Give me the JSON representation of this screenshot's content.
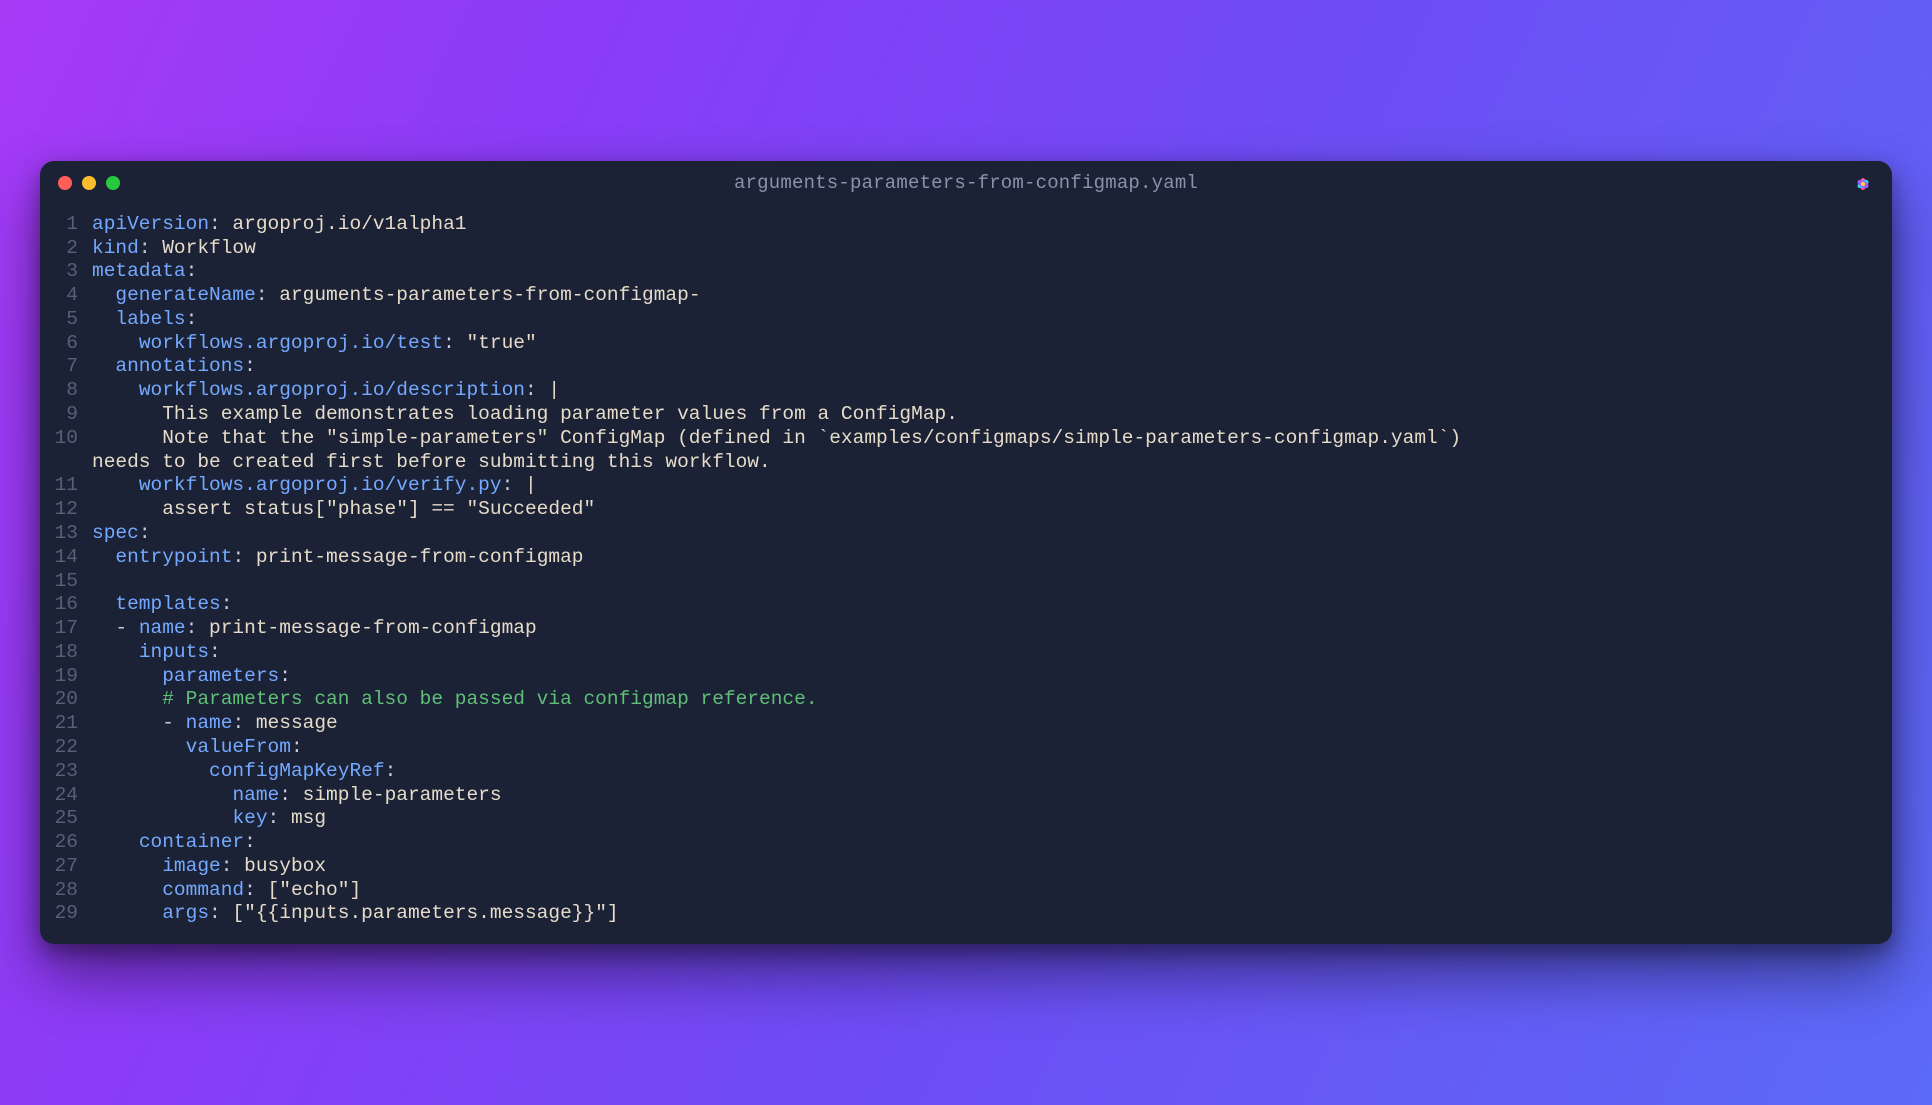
{
  "window": {
    "title": "arguments-parameters-from-configmap.yaml"
  },
  "trafficLights": {
    "close": "close",
    "minimize": "minimize",
    "zoom": "zoom"
  },
  "code": {
    "l1": {
      "k": "apiVersion",
      "c": ":",
      "v": " argoproj.io/v1alpha1"
    },
    "l2": {
      "k": "kind",
      "c": ":",
      "v": " Workflow"
    },
    "l3": {
      "k": "metadata",
      "c": ":"
    },
    "l4": {
      "i": "  ",
      "k": "generateName",
      "c": ":",
      "v": " arguments-parameters-from-configmap-"
    },
    "l5": {
      "i": "  ",
      "k": "labels",
      "c": ":"
    },
    "l6": {
      "i": "    ",
      "k": "workflows.argoproj.io/test",
      "c": ":",
      "v": " \"true\""
    },
    "l7": {
      "i": "  ",
      "k": "annotations",
      "c": ":"
    },
    "l8": {
      "i": "    ",
      "k": "workflows.argoproj.io/description",
      "c": ":",
      "v": " |"
    },
    "l9": {
      "v": "      This example demonstrates loading parameter values from a ConfigMap."
    },
    "l10a": {
      "v": "      Note that the \"simple-parameters\" ConfigMap (defined in `examples/configmaps/simple-parameters-configmap.yaml`) "
    },
    "l10b": {
      "v": "needs to be created first before submitting this workflow."
    },
    "l11": {
      "i": "    ",
      "k": "workflows.argoproj.io/verify.py",
      "c": ":",
      "v": " |"
    },
    "l12": {
      "v": "      assert status[\"phase\"] == \"Succeeded\""
    },
    "l13": {
      "k": "spec",
      "c": ":"
    },
    "l14": {
      "i": "  ",
      "k": "entrypoint",
      "c": ":",
      "v": " print-message-from-configmap"
    },
    "l15": {
      "v": ""
    },
    "l16": {
      "i": "  ",
      "k": "templates",
      "c": ":"
    },
    "l17": {
      "i": "  ",
      "d": "- ",
      "k": "name",
      "c": ":",
      "v": " print-message-from-configmap"
    },
    "l18": {
      "i": "    ",
      "k": "inputs",
      "c": ":"
    },
    "l19": {
      "i": "      ",
      "k": "parameters",
      "c": ":"
    },
    "l20": {
      "cm": "      # Parameters can also be passed via configmap reference."
    },
    "l21": {
      "i": "      ",
      "d": "- ",
      "k": "name",
      "c": ":",
      "v": " message"
    },
    "l22": {
      "i": "        ",
      "k": "valueFrom",
      "c": ":"
    },
    "l23": {
      "i": "          ",
      "k": "configMapKeyRef",
      "c": ":"
    },
    "l24": {
      "i": "            ",
      "k": "name",
      "c": ":",
      "v": " simple-parameters"
    },
    "l25": {
      "i": "            ",
      "k": "key",
      "c": ":",
      "v": " msg"
    },
    "l26": {
      "i": "    ",
      "k": "container",
      "c": ":"
    },
    "l27": {
      "i": "      ",
      "k": "image",
      "c": ":",
      "v": " busybox"
    },
    "l28": {
      "i": "      ",
      "k": "command",
      "c": ":",
      "v": " [\"echo\"]"
    },
    "l29": {
      "i": "      ",
      "k": "args",
      "c": ":",
      "v": " [\"{{inputs.parameters.message}}\"]"
    }
  },
  "gutters": {
    "n1": "1",
    "n2": "2",
    "n3": "3",
    "n4": "4",
    "n5": "5",
    "n6": "6",
    "n7": "7",
    "n8": "8",
    "n9": "9",
    "n10": "10",
    "n11": "11",
    "n12": "12",
    "n13": "13",
    "n14": "14",
    "n15": "15",
    "n16": "16",
    "n17": "17",
    "n18": "18",
    "n19": "19",
    "n20": "20",
    "n21": "21",
    "n22": "22",
    "n23": "23",
    "n24": "24",
    "n25": "25",
    "n26": "26",
    "n27": "27",
    "n28": "28",
    "n29": "29"
  }
}
